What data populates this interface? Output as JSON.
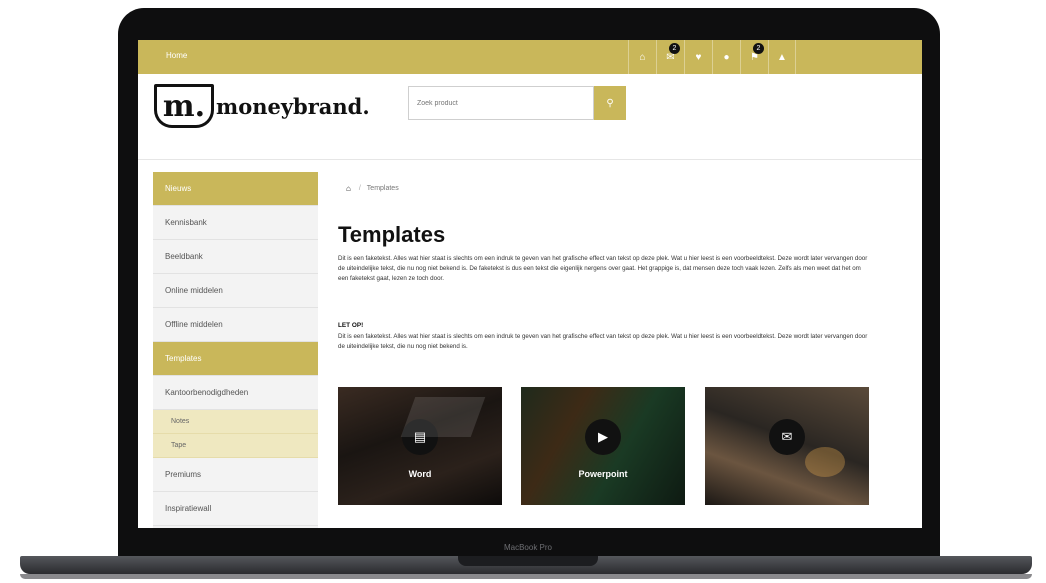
{
  "laptop": {
    "model_label": "MacBook Pro"
  },
  "topbar": {
    "home_label": "Home",
    "icons": [
      {
        "name": "home-icon",
        "glyph": "⌂",
        "badge": ""
      },
      {
        "name": "chat-icon",
        "glyph": "✉",
        "badge": "2"
      },
      {
        "name": "heart-icon",
        "glyph": "♥",
        "badge": ""
      },
      {
        "name": "user-icon",
        "glyph": "●",
        "badge": ""
      },
      {
        "name": "cart-icon",
        "glyph": "⚑",
        "badge": "2"
      },
      {
        "name": "bell-icon",
        "glyph": "▲",
        "badge": ""
      }
    ],
    "color": "#c9b75a"
  },
  "header": {
    "logo_mark": "m.",
    "logo_text": "moneybrand.",
    "search_placeholder": "Zoek product",
    "search_icon": "search-icon"
  },
  "sidebar": {
    "items": [
      {
        "label": "Nieuws",
        "active": true
      },
      {
        "label": "Kennisbank",
        "active": false
      },
      {
        "label": "Beeldbank",
        "active": false
      },
      {
        "label": "Online middelen",
        "active": false
      },
      {
        "label": "Offline middelen",
        "active": false
      },
      {
        "label": "Templates",
        "active": true
      },
      {
        "label": "Kantoorbenodigdheden",
        "active": false
      }
    ],
    "sub_items": [
      "Notes",
      "Tape"
    ],
    "after_items": [
      "Premiums",
      "Inspiratiewall"
    ]
  },
  "main": {
    "breadcrumb": "Templates",
    "title": "Templates",
    "paragraph1": "Dit is een faketekst. Alles wat hier staat is slechts om een indruk te geven van het grafische effect van tekst op deze plek. Wat u hier leest is een voorbeeldtekst. Deze wordt later vervangen door de uiteindelijke tekst, die nu nog niet bekend is. De faketekst is dus een tekst die eigenlijk nergens over gaat. Het grappige is, dat mensen deze toch vaak lezen. Zelfs als men weet dat het om een faketekst gaat, lezen ze toch door.",
    "letop_label": "LET OP!",
    "paragraph2": "Dit is een faketekst. Alles wat hier staat is slechts om een indruk te geven van het grafische effect van tekst op deze plek. Wat u hier leest is een voorbeeldtekst. Deze wordt later vervangen door de uiteindelijke tekst, die nu nog niet bekend is.",
    "cards": [
      {
        "label": "Word",
        "icon": "word-file-icon",
        "glyph": "▤"
      },
      {
        "label": "Powerpoint",
        "icon": "powerpoint-file-icon",
        "glyph": "▶"
      },
      {
        "label": "",
        "icon": "envelope-icon",
        "glyph": "✉"
      }
    ]
  }
}
